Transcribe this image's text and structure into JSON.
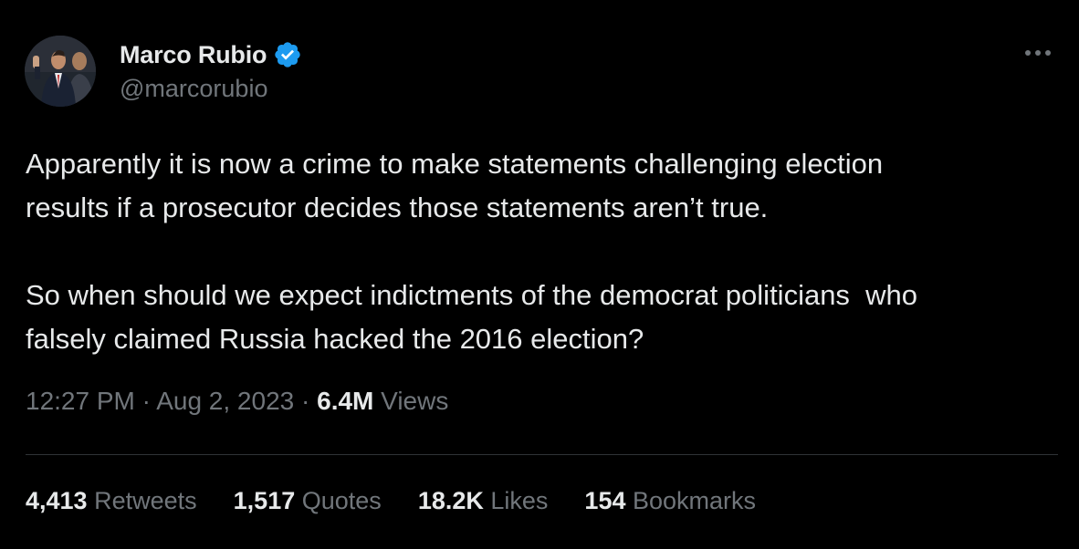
{
  "author": {
    "display_name": "Marco Rubio",
    "handle": "@marcorubio",
    "verified_icon": "verified-badge-icon",
    "verified_color": "#1d9bf0"
  },
  "more_icon": "more-horizontal-icon",
  "tweet": {
    "paragraphs": [
      "Apparently it is now a crime to make statements challenging election\nresults if a prosecutor decides those statements aren’t true.",
      "So when should we expect indictments of the democrat politicians  who\nfalsely claimed Russia hacked the 2016 election?"
    ]
  },
  "meta": {
    "time": "12:27 PM",
    "separator": " · ",
    "date": "Aug 2, 2023",
    "views_count": "6.4M",
    "views_label": "Views"
  },
  "stats": [
    {
      "count": "4,413",
      "label": "Retweets"
    },
    {
      "count": "1,517",
      "label": "Quotes"
    },
    {
      "count": "18.2K",
      "label": "Likes"
    },
    {
      "count": "154",
      "label": "Bookmarks"
    }
  ],
  "colors": {
    "background": "#000000",
    "primary_text": "#e7e9ea",
    "secondary_text": "#71767b",
    "divider": "#2f3336"
  }
}
